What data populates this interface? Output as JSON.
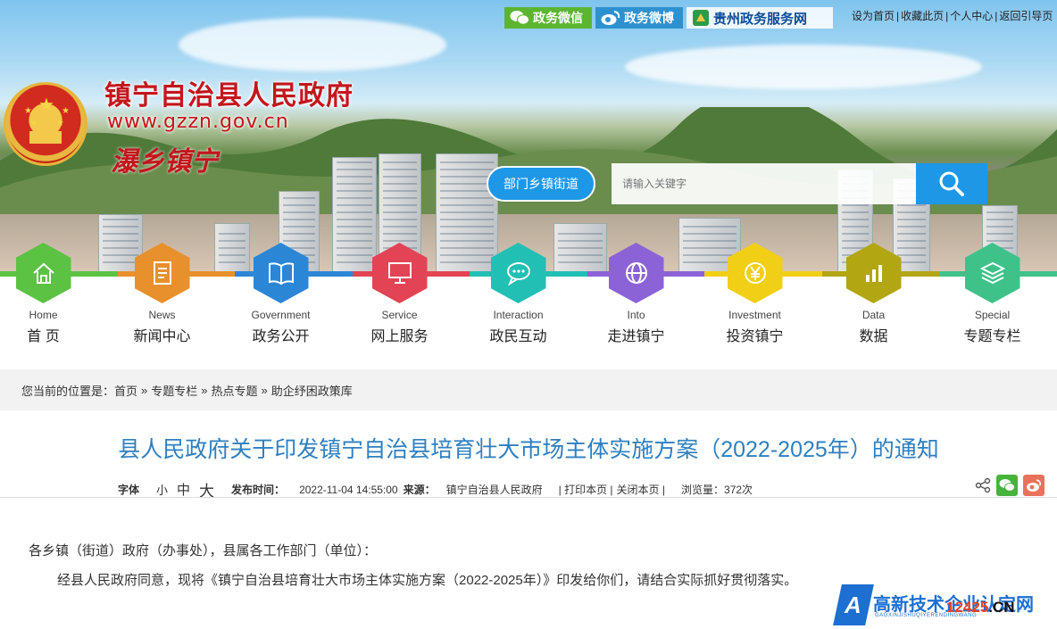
{
  "topbar": {
    "wechat_label": "政务微信",
    "weibo_label": "政务微博",
    "guizhou_label": "贵州政务服务网",
    "links": [
      "设为首页",
      "收藏此页",
      "个人中心",
      "返回引导页"
    ]
  },
  "site": {
    "title": "镇宁自治县人民政府",
    "url": "www.gzzn.gov.cn",
    "slogan": "瀑乡镇宁"
  },
  "search": {
    "dept_button": "部门乡镇街道",
    "placeholder": "请输入关键字",
    "icon": "search-icon"
  },
  "nav": {
    "items": [
      {
        "en": "Home",
        "cn": "首 页",
        "icon": "home-icon",
        "color": "#5cc243"
      },
      {
        "en": "News",
        "cn": "新闻中心",
        "icon": "document-icon",
        "color": "#e8902b"
      },
      {
        "en": "Government",
        "cn": "政务公开",
        "icon": "book-icon",
        "color": "#2c86d6"
      },
      {
        "en": "Service",
        "cn": "网上服务",
        "icon": "monitor-icon",
        "color": "#e24455"
      },
      {
        "en": "Interaction",
        "cn": "政民互动",
        "icon": "chat-icon",
        "color": "#22bfb4"
      },
      {
        "en": "Into",
        "cn": "走进镇宁",
        "icon": "globe-icon",
        "color": "#8b63d6"
      },
      {
        "en": "Investment",
        "cn": "投资镇宁",
        "icon": "yen-icon",
        "color": "#f0cf16"
      },
      {
        "en": "Data",
        "cn": "数据",
        "icon": "bar-chart-icon",
        "color": "#b2a613"
      },
      {
        "en": "Special",
        "cn": "专题专栏",
        "icon": "layers-icon",
        "color": "#3ec289"
      }
    ]
  },
  "breadcrumb": {
    "prefix": "您当前的位置是：",
    "items": [
      "首页",
      "专题专栏",
      "热点专题",
      "助企纾困政策库"
    ],
    "separator": "»"
  },
  "article": {
    "title": "县人民政府关于印发镇宁自治县培育壮大市场主体实施方案（2022-2025年）的通知",
    "font_label": "字体",
    "font_sizes": [
      "小",
      "中",
      "大"
    ],
    "publish_label": "发布时间：",
    "publish_time": "2022-11-04 14:55:00",
    "source_label": "来源：",
    "source": "镇宁自治县人民政府",
    "print_label": "| 打印本页 |",
    "close_label": "关闭本页 |",
    "views_label": "浏览量：",
    "views": "372次",
    "para1": "各乡镇（街道）政府（办事处），县属各工作部门（单位）：",
    "para2": "经县人民政府同意，现将《镇宁自治县培育壮大市场主体实施方案（2022-2025年）》印发给你们，请结合实际抓好贯彻落实。"
  },
  "watermark": {
    "letter": "A",
    "title": "高新技术企业认定网",
    "pinyin": "GAOXINJISHUQIYERENDINGWANG",
    "domain_prefix": "12425",
    "domain_suffix": ".CN"
  }
}
